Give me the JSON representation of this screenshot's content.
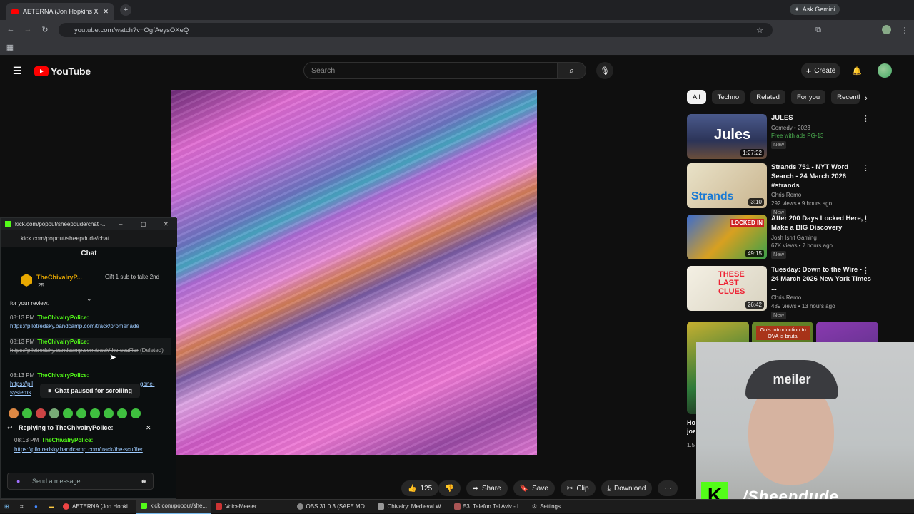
{
  "browser": {
    "tab_title": "AETERNA (Jon Hopkins X Coldp",
    "url": "youtube.com/watch?v=OgfAeysOXeQ",
    "ask_gemini": "Ask Gemini"
  },
  "youtube": {
    "logo_text": "YouTube",
    "search_placeholder": "Search",
    "create_label": "Create",
    "chips": [
      "All",
      "Techno",
      "Related",
      "For you",
      "Recently"
    ],
    "recommendations": [
      {
        "title": "JULES",
        "line1": "Comedy • 2023",
        "line2": "Free with ads  PG-13",
        "badge": "New",
        "duration": "1:27:22",
        "thumb_text": "Jules"
      },
      {
        "title": "Strands 751 - NYT Word Search - 24 March 2026 #strands",
        "line1": "Chris Remo",
        "line2": "292 views • 9 hours ago",
        "badge": "New",
        "duration": "3:10",
        "thumb_text": "Strands"
      },
      {
        "title": "After 200 Days Locked Here, I Make a BIG Discovery",
        "line1": "Josh Isn't Gaming",
        "line2": "67K views • 7 hours ago",
        "badge": "New",
        "duration": "49:15",
        "thumb_text": "LOCKED IN"
      },
      {
        "title": "Tuesday: Down to the Wire - 24 March 2026 New York Times ...",
        "line1": "Chris Remo",
        "line2": "489 views • 13 hours ago",
        "badge": "New",
        "duration": "26:42",
        "thumb_text": "THESE LAST CLUES"
      }
    ],
    "partial_rec_text": "Go's introduction to OVA is brutal",
    "partial_title": "Ho joe",
    "partial_meta": "1.5",
    "actions": {
      "likes": "125",
      "share": "Share",
      "save": "Save",
      "clip": "Clip",
      "download": "Download"
    }
  },
  "chat": {
    "window_title": "kick.com/popout/sheepdude/chat -...",
    "url": "kick.com/popout/sheepdude/chat",
    "header": "Chat",
    "pinned_user": "TheChivalryP...",
    "pinned_count": "25",
    "gift_text": "Gift 1 sub to take 2nd",
    "prev_line": "for your review.",
    "messages": [
      {
        "time": "08:13 PM",
        "user": "TheChivalryPolice:",
        "text": "https://pilotredsky.bandcamp.com/track/promenade",
        "deleted": ""
      },
      {
        "time": "08:13 PM",
        "user": "TheChivalryPolice:",
        "text": "https://pilotredsky.bandcamp.com/track/the-scuffler",
        "deleted": "(Deleted)"
      },
      {
        "time": "08:13 PM",
        "user": "TheChivalryPolice:",
        "text": "https://pil",
        "tail": "gone-",
        "tail2": "systems",
        "deleted": ""
      }
    ],
    "paused_label": "Chat paused for scrolling",
    "reply_header": "Replying to TheChivalryPolice:",
    "reply_time": "08:13 PM",
    "reply_user": "TheChivalryPolice:",
    "reply_link": "https://pilotredsky.bandcamp.com/track/the-scuffler",
    "send_placeholder": "Send a message"
  },
  "webcam": {
    "cap_text": "meiler",
    "brand": "/Sheepdude",
    "k": "K"
  },
  "taskbar": [
    {
      "label": "AETERNA (Jon Hopki...",
      "color": "#e44"
    },
    {
      "label": "kick.com/popout/she...",
      "color": "#53fc18",
      "active": true
    },
    {
      "label": "VoiceMeeter",
      "color": "#c33"
    },
    {
      "label": "OBS 31.0.3 (SAFE MO...",
      "color": "#888"
    },
    {
      "label": "Chivalry: Medieval W...",
      "color": "#999"
    },
    {
      "label": "53. Telefon Tel Aviv - I...",
      "color": "#a55"
    },
    {
      "label": "Settings",
      "color": "#aaa"
    }
  ]
}
